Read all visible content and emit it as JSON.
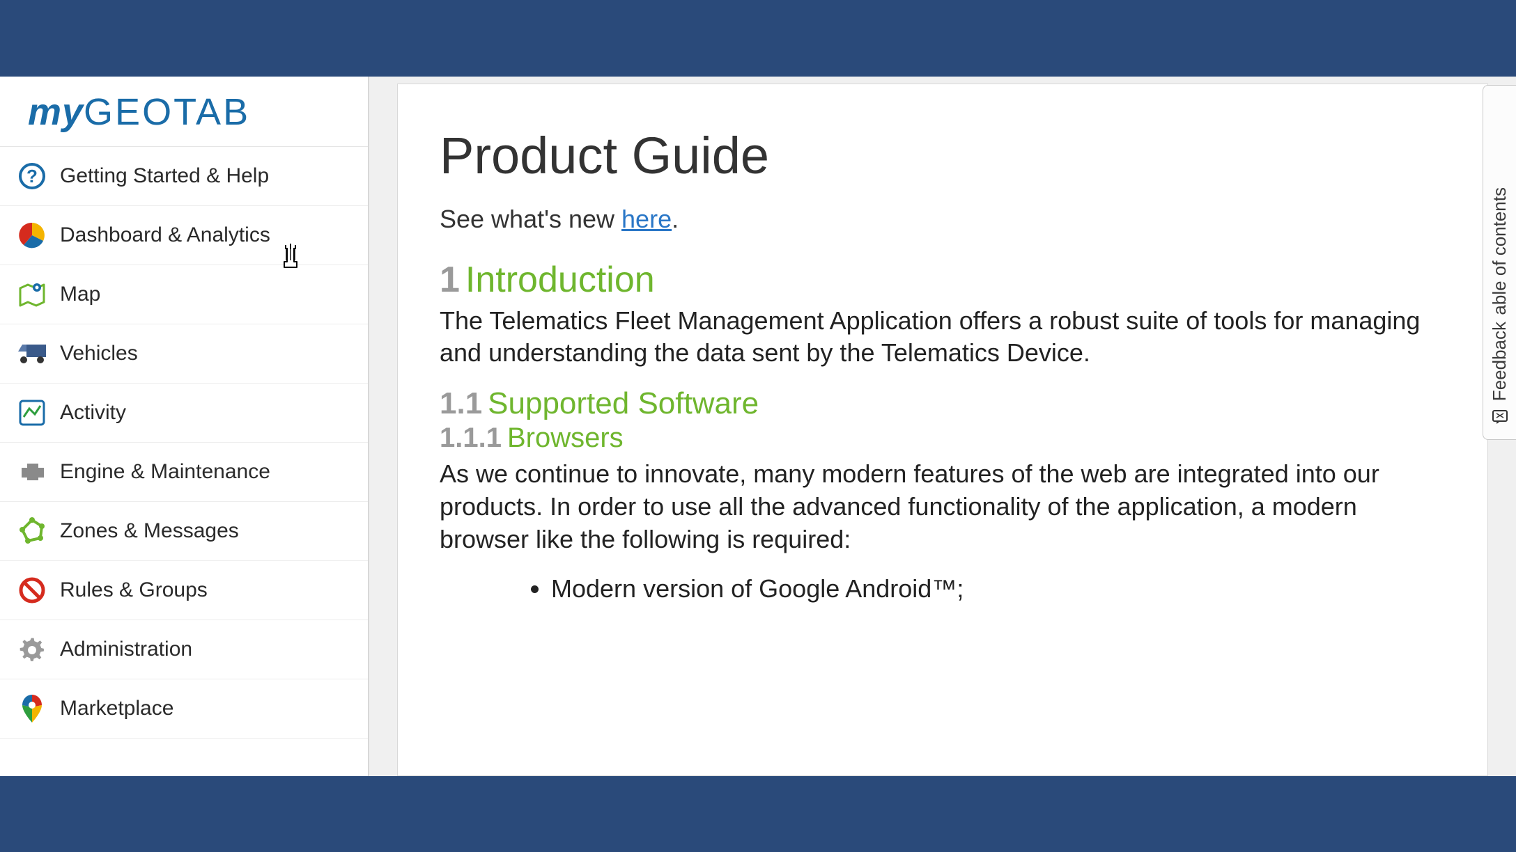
{
  "logo": {
    "prefix": "my",
    "suffix": "GEOTAB"
  },
  "sidebar": {
    "items": [
      {
        "label": "Getting Started & Help",
        "icon": "help"
      },
      {
        "label": "Dashboard & Analytics",
        "icon": "pie"
      },
      {
        "label": "Map",
        "icon": "map"
      },
      {
        "label": "Vehicles",
        "icon": "truck"
      },
      {
        "label": "Activity",
        "icon": "activity"
      },
      {
        "label": "Engine & Maintenance",
        "icon": "engine"
      },
      {
        "label": "Zones & Messages",
        "icon": "zones"
      },
      {
        "label": "Rules & Groups",
        "icon": "prohibit"
      },
      {
        "label": "Administration",
        "icon": "gear"
      },
      {
        "label": "Marketplace",
        "icon": "marketplace"
      }
    ]
  },
  "main": {
    "title": "Product Guide",
    "whatsnew_prefix": "See what's new ",
    "whatsnew_link": "here",
    "whatsnew_suffix": ".",
    "sec1_num": "1",
    "sec1_title": "Introduction",
    "sec1_body": "The Telematics Fleet Management Application offers a robust suite of tools for managing and understanding the data sent by the Telematics Device.",
    "sec11_num": "1.1",
    "sec11_title": "Supported Software",
    "sec111_num": "1.1.1",
    "sec111_title": "Browsers",
    "sec111_body": "As we continue to innovate, many modern features of the web are integrated into our products. In order to use all the advanced functionality of the application, a modern browser like the following is required:",
    "bullet1": "Modern version of Google Android™;"
  },
  "right_tab": {
    "text_top": "able of contents",
    "text_bottom": "Feedback"
  }
}
